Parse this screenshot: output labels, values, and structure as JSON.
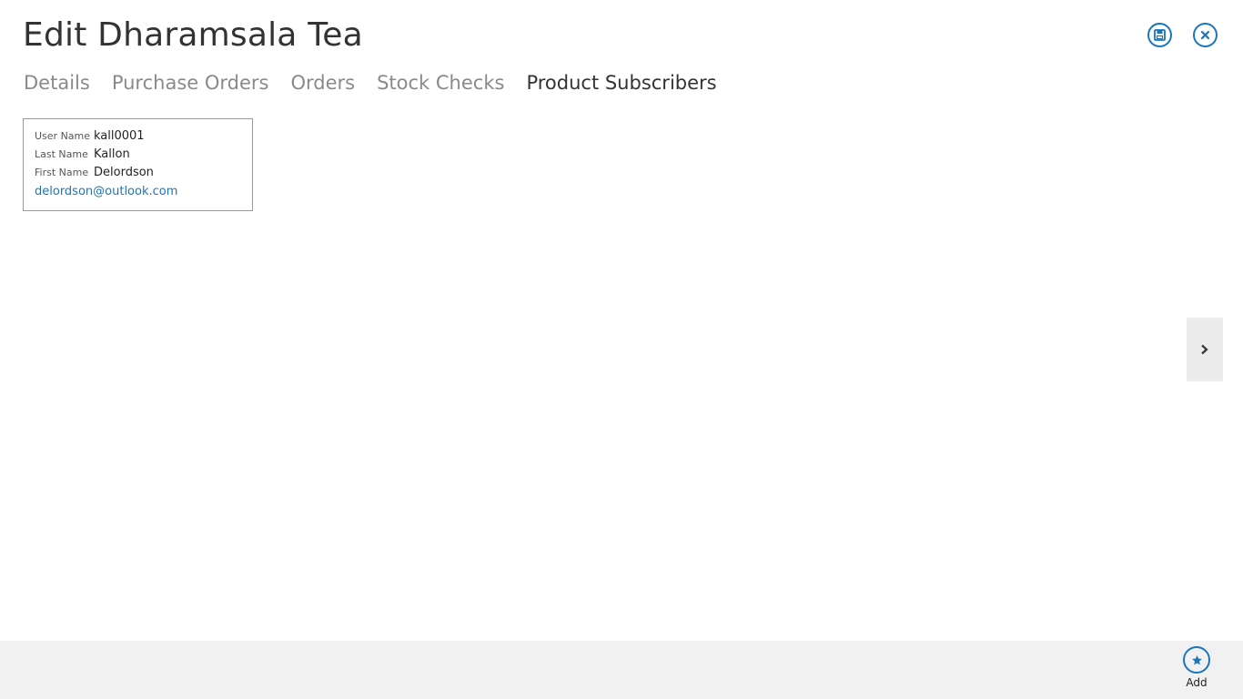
{
  "header": {
    "title": "Edit Dharamsala Tea"
  },
  "tabs": [
    {
      "label": "Details",
      "active": false
    },
    {
      "label": "Purchase Orders",
      "active": false
    },
    {
      "label": "Orders",
      "active": false
    },
    {
      "label": "Stock Checks",
      "active": false
    },
    {
      "label": "Product Subscribers",
      "active": true
    }
  ],
  "subscriber_card": {
    "user_name_label": "User Name",
    "user_name": "kall0001",
    "last_name_label": "Last Name",
    "last_name": "Kallon",
    "first_name_label": "First Name",
    "first_name": "Delordson",
    "email": "delordson@outlook.com"
  },
  "icons": {
    "save": "save-icon",
    "close": "close-icon",
    "next": "chevron-right-icon",
    "add": "star-icon"
  },
  "colors": {
    "accent": "#1b75bb",
    "command_bar": "#f1f1f1"
  },
  "command_bar": {
    "add_label": "Add"
  }
}
